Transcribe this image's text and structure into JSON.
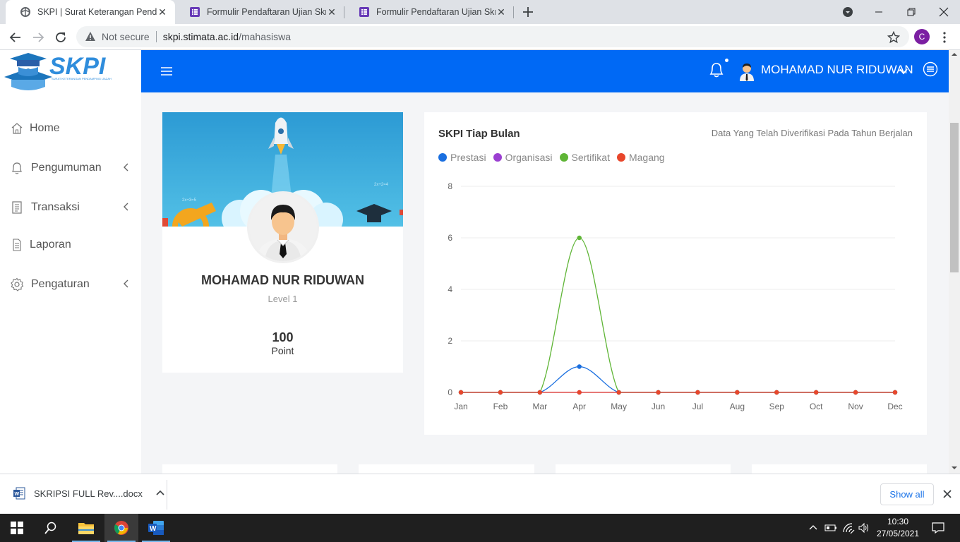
{
  "browser": {
    "tabs": [
      {
        "title": "SKPI | Surat Keterangan Pendamping Ijazah",
        "active": true,
        "icon": "globe-icon"
      },
      {
        "title": "Formulir Pendaftaran Ujian Skripsi",
        "active": false,
        "icon": "forms-icon"
      },
      {
        "title": "Formulir Pendaftaran Ujian Skripsi",
        "active": false,
        "icon": "forms-icon"
      }
    ],
    "address": {
      "security_label": "Not secure",
      "host": "skpi.stimata.ac.id",
      "path": "/mahasiswa"
    },
    "profile_initial": "C"
  },
  "sidebar": {
    "logo_text": "SKPI",
    "logo_tagline": "SURAT KETERANGAN PENDAMPING IJAZAH",
    "items": [
      {
        "label": "Home",
        "icon": "home-icon",
        "has_submenu": false
      },
      {
        "label": "Pengumuman",
        "icon": "bell-icon",
        "has_submenu": true
      },
      {
        "label": "Transaksi",
        "icon": "clipboard-icon",
        "has_submenu": true
      },
      {
        "label": "Laporan",
        "icon": "document-icon",
        "has_submenu": false
      },
      {
        "label": "Pengaturan",
        "icon": "gear-icon",
        "has_submenu": true
      }
    ]
  },
  "topbar": {
    "user_name": "MOHAMAD NUR RIDUWAN",
    "accent_color": "#0069f5"
  },
  "profile_card": {
    "name": "MOHAMAD NUR RIDUWAN",
    "level": "Level 1",
    "points": "100",
    "points_label": "Point"
  },
  "chart_card": {
    "title": "SKPI Tiap Bulan",
    "subtitle": "Data Yang Telah Diverifikasi Pada Tahun Berjalan"
  },
  "chart_data": {
    "type": "line",
    "title": "SKPI Tiap Bulan",
    "x": [
      "Jan",
      "Feb",
      "Mar",
      "Apr",
      "May",
      "Jun",
      "Jul",
      "Aug",
      "Sep",
      "Oct",
      "Nov",
      "Dec"
    ],
    "ylim": [
      0,
      8
    ],
    "yticks": [
      0,
      2,
      4,
      6,
      8
    ],
    "grid": true,
    "legend_position": "top-left",
    "series": [
      {
        "name": "Prestasi",
        "color": "#1a6fe0",
        "values": [
          0,
          0,
          0,
          1,
          0,
          0,
          0,
          0,
          0,
          0,
          0,
          0
        ]
      },
      {
        "name": "Organisasi",
        "color": "#9b3fd1",
        "values": [
          0,
          0,
          0,
          0,
          0,
          0,
          0,
          0,
          0,
          0,
          0,
          0
        ]
      },
      {
        "name": "Sertifikat",
        "color": "#5fb536",
        "values": [
          0,
          0,
          0,
          6,
          0,
          0,
          0,
          0,
          0,
          0,
          0,
          0
        ]
      },
      {
        "name": "Magang",
        "color": "#e8462b",
        "values": [
          0,
          0,
          0,
          0,
          0,
          0,
          0,
          0,
          0,
          0,
          0,
          0
        ]
      }
    ]
  },
  "download_bar": {
    "file_name": "SKRIPSI FULL Rev....docx",
    "show_all_label": "Show all"
  },
  "taskbar": {
    "time": "10:30",
    "date": "27/05/2021"
  }
}
